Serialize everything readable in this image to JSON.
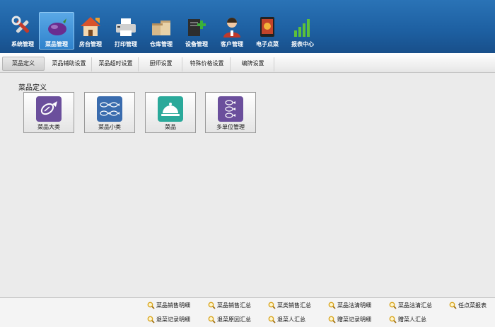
{
  "toolbar": [
    {
      "label": "系统管理",
      "icon": "tools-icon"
    },
    {
      "label": "菜品管理",
      "icon": "eggplant-icon"
    },
    {
      "label": "房台管理",
      "icon": "house-icon"
    },
    {
      "label": "打印管理",
      "icon": "printer-icon"
    },
    {
      "label": "仓库管理",
      "icon": "boxes-icon"
    },
    {
      "label": "设备管理",
      "icon": "device-add-icon"
    },
    {
      "label": "客户管理",
      "icon": "customer-icon"
    },
    {
      "label": "电子点菜",
      "icon": "tablet-menu-icon"
    },
    {
      "label": "报表中心",
      "icon": "bar-chart-icon"
    }
  ],
  "active_tool": "菜品管理",
  "tabs": [
    "菜品定义",
    "菜品辅助设置",
    "菜品超时设置",
    "厨师设置",
    "特殊价格设置",
    "编牌设置"
  ],
  "active_tab": "菜品定义",
  "section_title": "菜品定义",
  "cards": [
    {
      "label": "菜品大类",
      "icon": "fish-icon",
      "color": "#6b4f9c"
    },
    {
      "label": "菜品小类",
      "icon": "fish-group-icon",
      "color": "#3a6cae"
    },
    {
      "label": "菜品",
      "icon": "dish-cover-icon",
      "color": "#2aa99a"
    },
    {
      "label": "多单位管理",
      "icon": "fish-stack-icon",
      "color": "#6b4f9c"
    }
  ],
  "reports": {
    "row1": [
      "菜品销售明细",
      "菜品销售汇总",
      "菜类销售汇总",
      "菜品沽清明细",
      "菜品沽清汇总",
      "任点菜报表"
    ],
    "row2": [
      "退菜记录明细",
      "退菜原因汇总",
      "退菜人汇总",
      "赠菜记录明细",
      "赠菜人汇总"
    ]
  },
  "colors": {
    "toolbar_bg": "#1d5fa1",
    "active_tool": "#4b9be0",
    "content_bg": "#ebebeb"
  }
}
